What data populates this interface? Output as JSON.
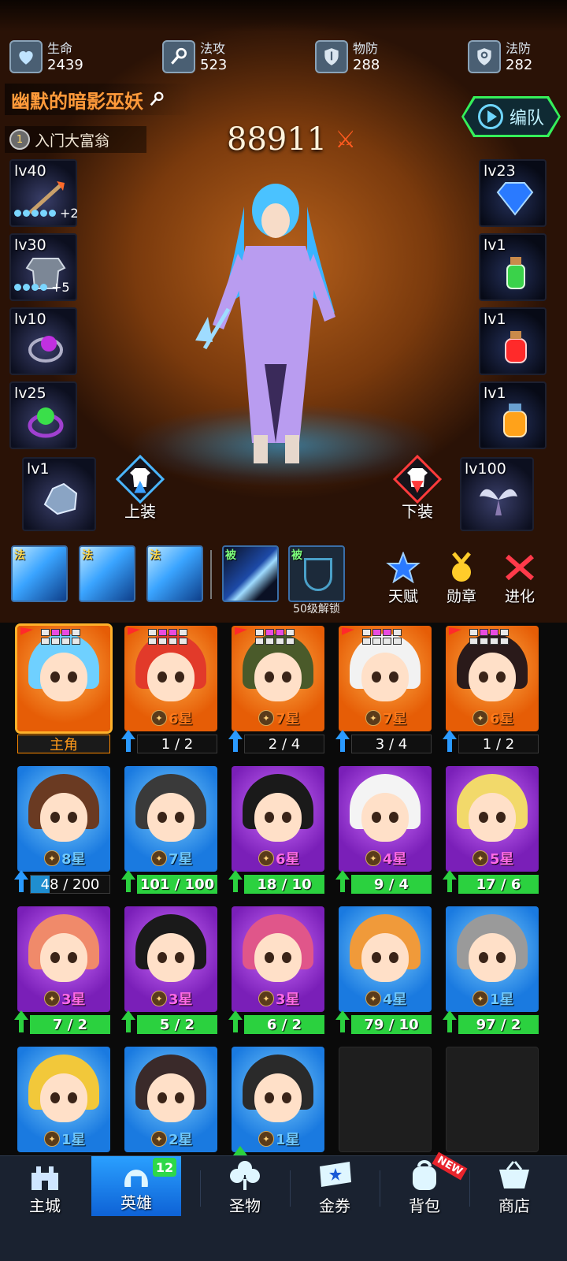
{
  "stats": [
    {
      "label": "生命",
      "value": "2439",
      "icon": "heart-icon"
    },
    {
      "label": "法攻",
      "value": "523",
      "icon": "wand-icon"
    },
    {
      "label": "物防",
      "value": "288",
      "icon": "shield-sword-icon"
    },
    {
      "label": "法防",
      "value": "282",
      "icon": "shield-magic-icon"
    }
  ],
  "hero": {
    "name": "幽默的暗影巫妖",
    "title": "入门大富翁",
    "title_rank": "1",
    "power": "88911"
  },
  "team_button": "编队",
  "equipment_left": [
    {
      "level": "lv40",
      "plus": "+2",
      "dots": 5,
      "item": "staff-weapon"
    },
    {
      "level": "lv30",
      "plus": "+5",
      "dots": 4,
      "item": "armor"
    },
    {
      "level": "lv10",
      "plus": "",
      "dots": 0,
      "item": "purple-ring"
    },
    {
      "level": "lv25",
      "plus": "",
      "dots": 0,
      "item": "green-ring"
    }
  ],
  "equipment_right": [
    {
      "level": "lv23",
      "item": "blue-gem"
    },
    {
      "level": "lv1",
      "item": "green-potion"
    },
    {
      "level": "lv1",
      "item": "red-potion"
    },
    {
      "level": "lv1",
      "item": "orange-potion"
    }
  ],
  "bottom_slots": [
    {
      "level": "lv1",
      "item": "crystal-ore"
    },
    {
      "level": "lv100",
      "item": "wings"
    }
  ],
  "equip_actions": {
    "equip": "上装",
    "unequip": "下装"
  },
  "skills": [
    {
      "tag": "法",
      "type": "active"
    },
    {
      "tag": "法",
      "type": "active"
    },
    {
      "tag": "法",
      "type": "active"
    },
    {
      "tag": "被",
      "type": "passive"
    },
    {
      "tag": "被",
      "type": "passive",
      "locked_text": "50级解锁"
    }
  ],
  "side_buttons": [
    "天赋",
    "勋章",
    "进化"
  ],
  "heroes": [
    {
      "bg": "orange",
      "stars": "",
      "bar": "主角",
      "bar_type": "main",
      "selected": true,
      "gems": true,
      "hair": "#6fd0ff",
      "arrow": false
    },
    {
      "bg": "orange",
      "stars": "6星",
      "bar": "1 / 2",
      "bar_type": "dark",
      "gems": true,
      "hair": "#e23a2a",
      "arrow": true,
      "star_color": "or"
    },
    {
      "bg": "orange",
      "stars": "7星",
      "bar": "2 / 4",
      "bar_type": "dark",
      "gems": true,
      "hair": "#4a5a2a",
      "arrow": true,
      "star_color": "or"
    },
    {
      "bg": "orange",
      "stars": "7星",
      "bar": "3 / 4",
      "bar_type": "dark",
      "gems": true,
      "hair": "#f2f2f2",
      "arrow": true,
      "star_color": "or"
    },
    {
      "bg": "orange",
      "stars": "6星",
      "bar": "1 / 2",
      "bar_type": "dark",
      "gems": true,
      "hair": "#2a1a1a",
      "arrow": true,
      "star_color": "or"
    },
    {
      "bg": "blue",
      "stars": "8星",
      "bar": "48 / 200",
      "bar_type": "progress",
      "progress": 0.24,
      "hair": "#6a3a22",
      "arrow": true,
      "arrow_color": "blue",
      "star_color": "bl"
    },
    {
      "bg": "blue",
      "stars": "7星",
      "bar": "101 / 100",
      "bar_type": "green",
      "hair": "#3a3a3a",
      "arrow": true,
      "star_color": "bl"
    },
    {
      "bg": "purple",
      "stars": "6星",
      "bar": "18 / 10",
      "bar_type": "green",
      "hair": "#1a1a1a",
      "arrow": true,
      "star_color": "pu"
    },
    {
      "bg": "purple",
      "stars": "4星",
      "bar": "9 / 4",
      "bar_type": "green",
      "hair": "#f4f4f4",
      "arrow": true,
      "star_color": "pu"
    },
    {
      "bg": "purple",
      "stars": "5星",
      "bar": "17 / 6",
      "bar_type": "green",
      "hair": "#f2d96a",
      "arrow": true,
      "star_color": "pu"
    },
    {
      "bg": "purple",
      "stars": "3星",
      "bar": "7 / 2",
      "bar_type": "green",
      "hair": "#f08a6a",
      "arrow": true,
      "star_color": "pu"
    },
    {
      "bg": "purple",
      "stars": "3星",
      "bar": "5 / 2",
      "bar_type": "green",
      "hair": "#1a1a1a",
      "arrow": true,
      "star_color": "pu"
    },
    {
      "bg": "purple",
      "stars": "3星",
      "bar": "6 / 2",
      "bar_type": "green",
      "hair": "#e0568a",
      "arrow": true,
      "star_color": "pu"
    },
    {
      "bg": "blue",
      "stars": "4星",
      "bar": "79 / 10",
      "bar_type": "green",
      "hair": "#f09a3a",
      "arrow": true,
      "star_color": "bl"
    },
    {
      "bg": "blue",
      "stars": "1星",
      "bar": "97 / 2",
      "bar_type": "green",
      "hair": "#9a9a9a",
      "arrow": true,
      "star_color": "bl"
    },
    {
      "bg": "blue",
      "stars": "1星",
      "bar": "",
      "bar_type": "none",
      "hair": "#f2c83a",
      "arrow": false,
      "star_color": "bl"
    },
    {
      "bg": "blue",
      "stars": "2星",
      "bar": "",
      "bar_type": "none",
      "hair": "#3a2a2a",
      "arrow": false,
      "star_color": "bl"
    },
    {
      "bg": "blue",
      "stars": "1星",
      "bar": "",
      "bar_type": "none",
      "hair": "#2a2a2a",
      "arrow": true,
      "star_color": "bl"
    },
    {
      "bg": "empty"
    },
    {
      "bg": "empty"
    }
  ],
  "nav": [
    {
      "label": "主城",
      "icon": "castle-icon"
    },
    {
      "label": "英雄",
      "icon": "hero-helmet-icon",
      "active": true,
      "badge": "12"
    },
    {
      "label": "圣物",
      "icon": "clover-icon"
    },
    {
      "label": "金券",
      "icon": "ticket-icon"
    },
    {
      "label": "背包",
      "icon": "backpack-icon",
      "new": "NEW"
    },
    {
      "label": "商店",
      "icon": "basket-icon"
    }
  ]
}
